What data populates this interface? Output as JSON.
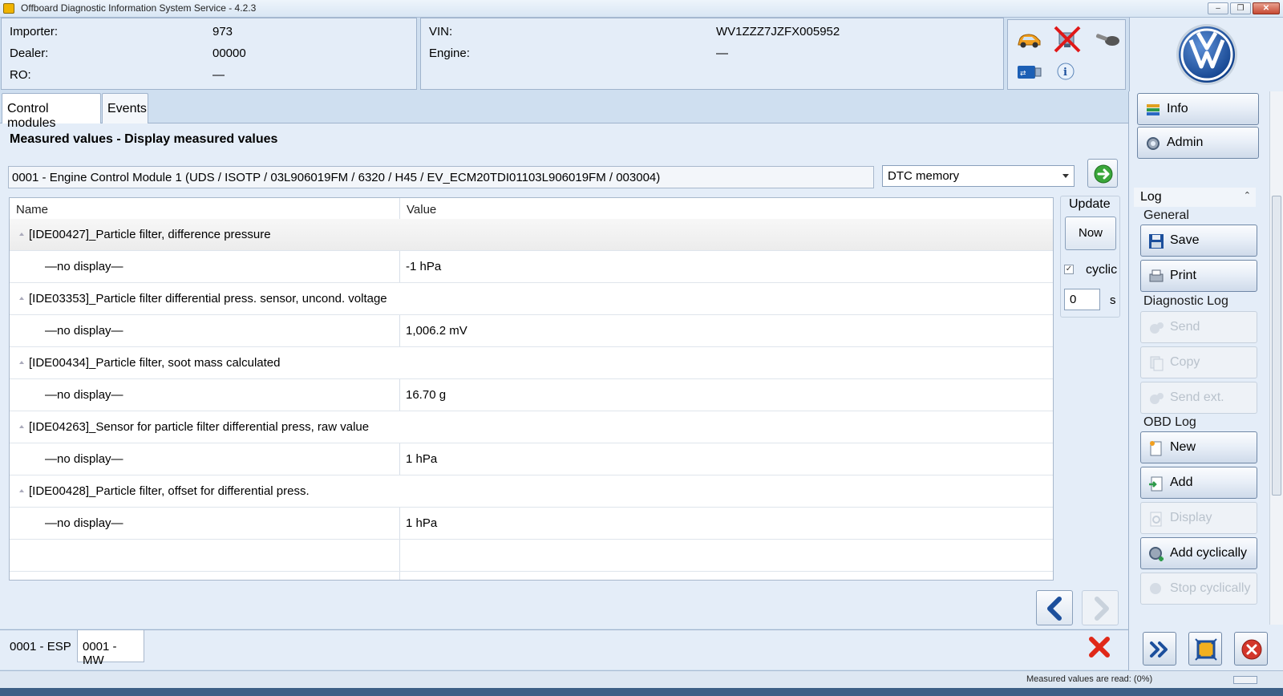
{
  "window": {
    "title": "Offboard Diagnostic Information System Service - 4.2.3",
    "controls": [
      "minimize",
      "restore",
      "close"
    ]
  },
  "header": {
    "importer_label": "Importer:",
    "importer_value": "973",
    "dealer_label": "Dealer:",
    "dealer_value": "00000",
    "ro_label": "RO:",
    "ro_value": "—",
    "vin_label": "VIN:",
    "vin_value": "WV1ZZZ7JZFX005952",
    "engine_label": "Engine:",
    "engine_value": "—"
  },
  "status_icons": [
    "car-icon",
    "network-disconnected-icon",
    "key-icon",
    "usb-icon",
    "info-icon"
  ],
  "tabs": [
    {
      "label": "Control modules"
    },
    {
      "label": "Events"
    }
  ],
  "main": {
    "section_title": "Measured values - Display measured values",
    "ecu": "0001 - Engine Control Module 1  (UDS / ISOTP / 03L906019FM / 6320 / H45 / EV_ECM20TDI01103L906019FM / 003004)",
    "dropdown_value": "DTC memory",
    "table": {
      "headers": [
        "Name",
        "Value"
      ],
      "rows": [
        {
          "name": "[IDE00427]_Particle filter, difference pressure",
          "value": "",
          "group": true
        },
        {
          "name": "—no display—",
          "value": "-1 hPa",
          "group": false
        },
        {
          "name": "[IDE03353]_Particle filter differential press. sensor, uncond. voltage",
          "value": "",
          "group": true
        },
        {
          "name": "—no display—",
          "value": "1,006.2 mV",
          "group": false
        },
        {
          "name": "[IDE00434]_Particle filter, soot mass calculated",
          "value": "",
          "group": true
        },
        {
          "name": "—no display—",
          "value": "16.70 g",
          "group": false
        },
        {
          "name": "[IDE04263]_Sensor for particle filter differential press, raw value",
          "value": "",
          "group": true
        },
        {
          "name": "—no display—",
          "value": "1 hPa",
          "group": false
        },
        {
          "name": "[IDE00428]_Particle filter, offset for differential press.",
          "value": "",
          "group": true
        },
        {
          "name": "—no display—",
          "value": "1 hPa",
          "group": false
        }
      ]
    },
    "update": {
      "label": "Update",
      "now_label": "Now",
      "cyclic_label": "cyclic",
      "cyclic_checked": true,
      "seconds_value": "0",
      "seconds_unit": "s"
    }
  },
  "bottom_tabs": [
    {
      "label": "0001 - ESP"
    },
    {
      "label": "0001 - MW"
    }
  ],
  "sidebar": {
    "info_label": "Info",
    "admin_label": "Admin",
    "log_label": "Log",
    "general_label": "General",
    "save_label": "Save",
    "print_label": "Print",
    "diag_log_label": "Diagnostic Log",
    "send_label": "Send",
    "copy_label": "Copy",
    "send_ext_label": "Send ext.",
    "obd_log_label": "OBD Log",
    "new_label": "New",
    "add_label": "Add",
    "display_label": "Display",
    "add_cyclically_label": "Add cyclically",
    "stop_cyclically_label": "Stop cyclically"
  },
  "statusbar": {
    "message": "Measured values are read: (0%)"
  },
  "colors": {
    "panel": "#e4edf8",
    "border": "#9fb3cc",
    "accent_blue": "#1c4f9c",
    "close_red": "#d3362a",
    "go_green": "#3aa63a"
  }
}
